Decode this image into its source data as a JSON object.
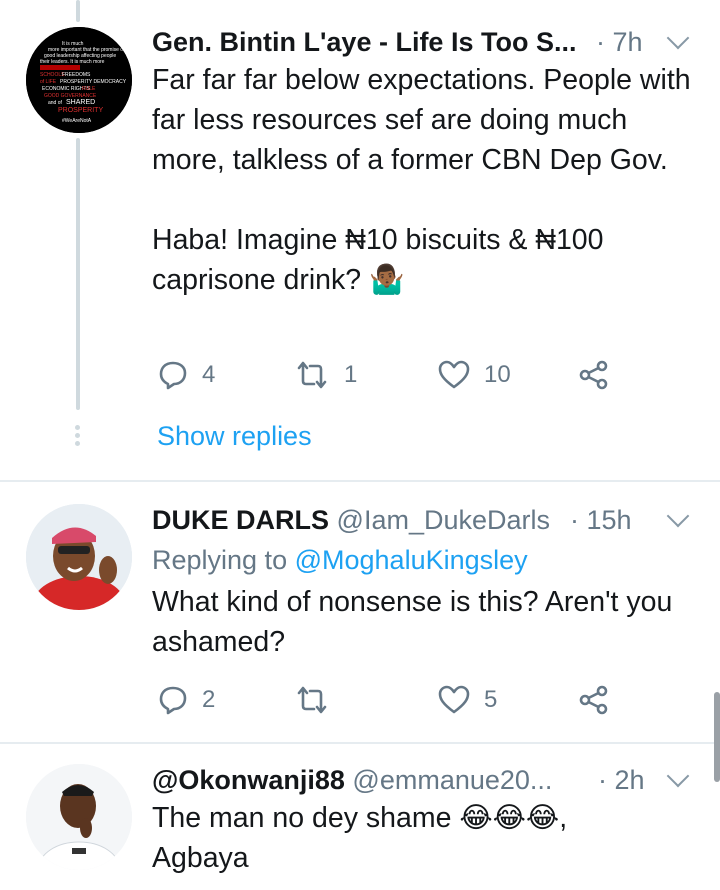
{
  "tweets": [
    {
      "name": "Gen. Bintin L'aye - Life Is Too S...",
      "handle": "",
      "time": "· 7h",
      "replying_label": "",
      "replying_to": "",
      "text": "Far far far below expectations. People with far less resources sef are doing much more, talkless of a former CBN Dep Gov.\n\nHaba! Imagine ₦10 biscuits & ₦100 caprisone drink? 🤷🏾‍♂️",
      "replies": "4",
      "retweets": "1",
      "likes": "10",
      "show_replies": "Show replies",
      "avatar_text": "It is much more important that the promise of SHARED PROSPERITY ... #WeAreNotA"
    },
    {
      "name": "DUKE DARLS",
      "handle": "@Iam_DukeDarls",
      "time": "· 15h",
      "replying_label": "Replying to",
      "replying_to": "@MoghaluKingsley",
      "text": "What kind of nonsense is this? Aren't you ashamed?",
      "replies": "2",
      "retweets": "",
      "likes": "5"
    },
    {
      "name": "@Okonwanji88",
      "handle": "@emmanue20...",
      "time": "· 2h",
      "text": "The man no dey shame 😂😂😂,\nAgbaya"
    }
  ],
  "icons": {
    "reply": "reply-icon",
    "retweet": "retweet-icon",
    "like": "heart-icon",
    "share": "share-icon",
    "caret": "chevron-down-icon"
  },
  "colors": {
    "link": "#1da1f2",
    "secondary_text": "#657786",
    "thread_line": "#cfd9de",
    "divider": "#e6ecf0"
  }
}
